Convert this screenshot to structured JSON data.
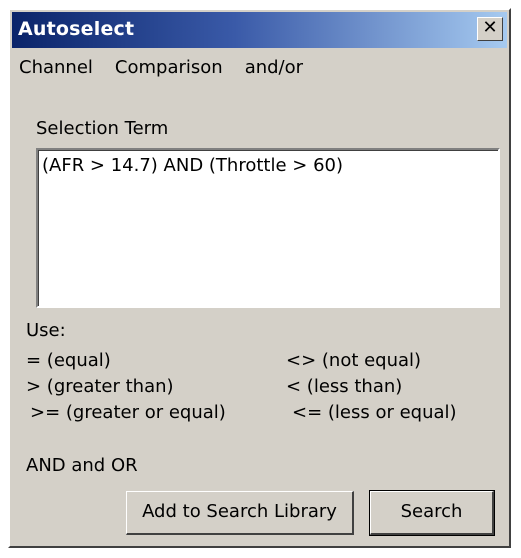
{
  "window": {
    "title": "Autoselect",
    "close_glyph": "✕"
  },
  "menu": {
    "items": [
      "Channel",
      "Comparison",
      "and/or"
    ]
  },
  "selection": {
    "label": "Selection Term",
    "value": "(AFR > 14.7) AND (Throttle > 60)"
  },
  "help": {
    "use_label": "Use:",
    "equal": "= (equal)",
    "not_equal": "<> (not equal)",
    "greater": "> (greater than)",
    "less": "< (less than)",
    "greater_equal": ">= (greater or equal)",
    "less_equal": "<= (less or equal)",
    "and_or": "AND and OR"
  },
  "buttons": {
    "add_library": "Add to Search Library",
    "search": "Search"
  },
  "colors": {
    "face": "#d4d0c8",
    "title_start": "#0a246a",
    "title_end": "#a6caf0"
  }
}
